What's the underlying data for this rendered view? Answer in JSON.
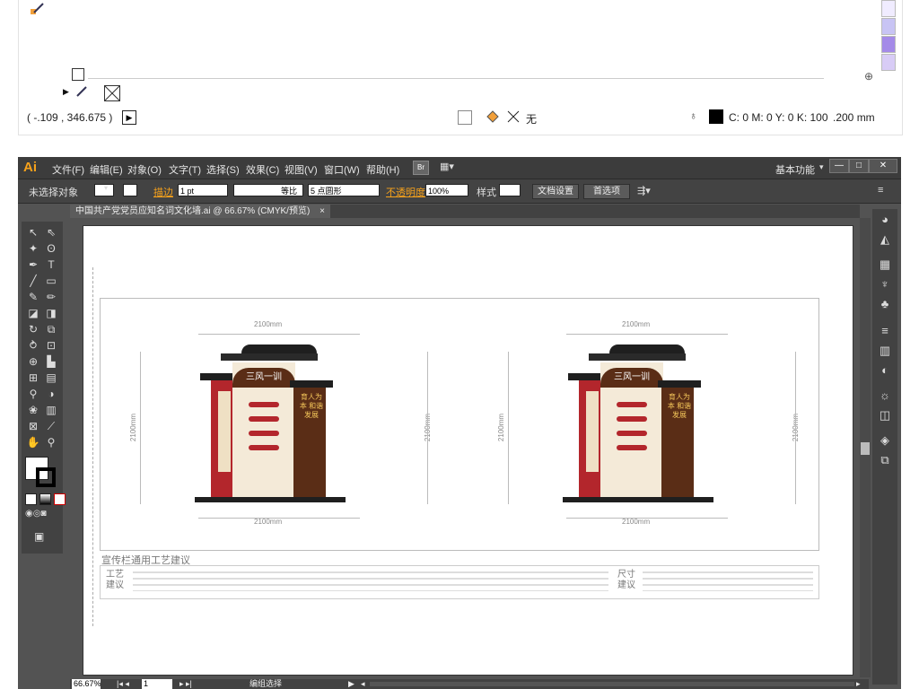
{
  "info_panel": {
    "coordinates": "( -.109 , 346.675 )",
    "fill_none_label": "无",
    "color_values": "C: 0 M: 0 Y: 0 K: 100",
    "stroke_width": ".200 mm"
  },
  "app": {
    "logo": "Ai",
    "menus": [
      "文件(F)",
      "编辑(E)",
      "对象(O)",
      "文字(T)",
      "选择(S)",
      "效果(C)",
      "视图(V)",
      "窗口(W)",
      "帮助(H)"
    ],
    "bridge_label": "Br",
    "workspace": "基本功能",
    "window_buttons": [
      "—",
      "□",
      "✕"
    ]
  },
  "control_bar": {
    "selection_label": "未选择对象",
    "stroke_label": "描边",
    "stroke_value": "1 pt",
    "stroke_profile": "等比",
    "brush_value": "5 点圆形",
    "opacity_label": "不透明度",
    "opacity_value": "100%",
    "style_label": "样式",
    "doc_settings_button": "文档设置",
    "preferences_button": "首选项"
  },
  "document_tab": {
    "title": "中国共产党党员应知名词文化墙.ai @ 66.67% (CMYK/预览)",
    "close": "×"
  },
  "artwork": {
    "dim_top_left": "2100mm",
    "dim_top_right": "2100mm",
    "dim_bottom_left": "2100mm",
    "dim_bottom_right": "2100mm",
    "dim_side_left_a": "2100mm",
    "dim_side_left_b": "2100mm",
    "dim_side_right_a": "2100mm",
    "dim_side_right_b": "2100mm",
    "sign_title": "三风一训",
    "sign_slogan": "育人为本 和谐发展",
    "section_heading": "宣传栏通用工艺建议",
    "craft_label": "工艺建议",
    "size_label": "尺寸建议"
  },
  "status_bar": {
    "zoom": "66.67%",
    "page": "1",
    "mode": "编组选择"
  },
  "colors": {
    "sign_red": "#b3262c",
    "sign_brown": "#5a2d16",
    "roof_black": "#1f1f1f",
    "accent_orange": "#f7a21b"
  }
}
